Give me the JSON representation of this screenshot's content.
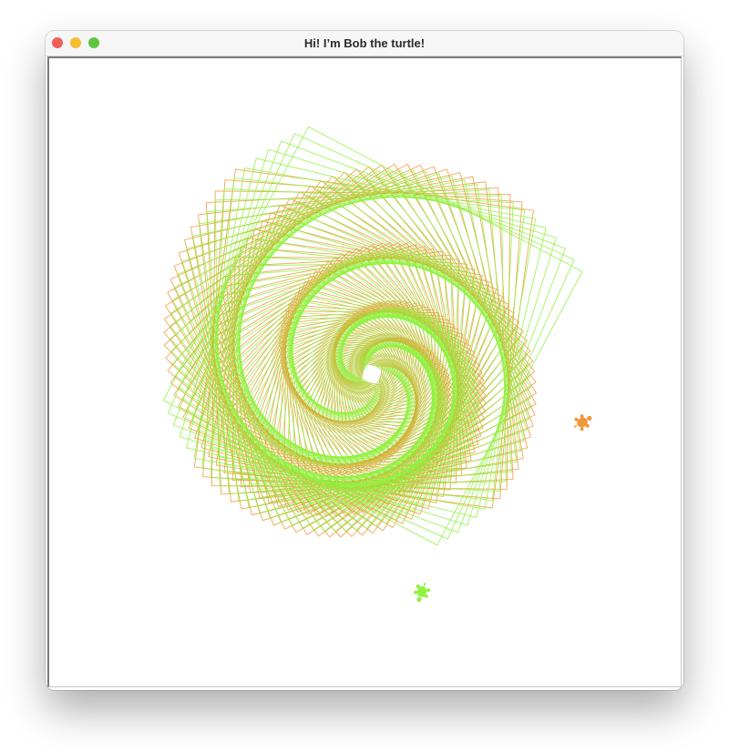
{
  "window": {
    "title": "Hi! I’m Bob the turtle!",
    "buttons": {
      "close_color": "#ee5f58",
      "minimize_color": "#f5bd2f",
      "maximize_color": "#5ec540"
    }
  },
  "canvas": {
    "background": "#ffffff",
    "pattern": "rotating squares spiral",
    "turtles": [
      {
        "name": "orange turtle",
        "color": "#f0973a",
        "heading_deg": -30
      },
      {
        "name": "green turtle",
        "color": "#8ff23f",
        "heading_deg": 110
      }
    ],
    "pens": [
      {
        "color": "#f0973a"
      },
      {
        "color": "#8ff23f"
      }
    ]
  }
}
